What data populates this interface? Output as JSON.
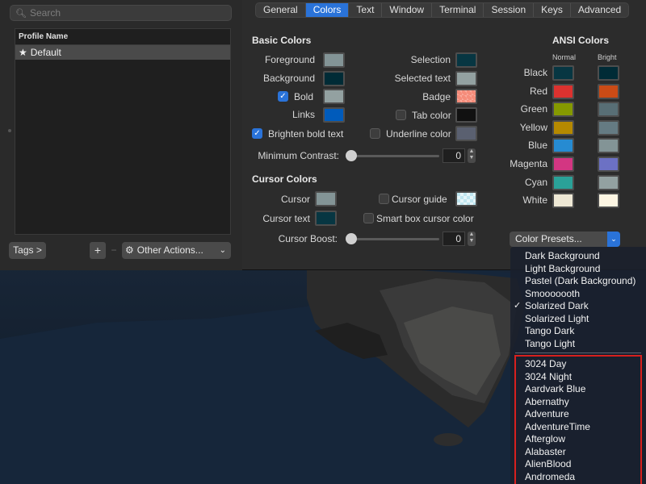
{
  "search": {
    "placeholder": "Search"
  },
  "profiles": {
    "header": "Profile Name",
    "items": [
      {
        "label": "Default",
        "is_default": true
      }
    ]
  },
  "bottom_bar": {
    "tags_label": "Tags >",
    "add_label": "+",
    "remove_label": "−",
    "other_actions_label": "Other Actions..."
  },
  "tabs": [
    {
      "label": "General",
      "active": false
    },
    {
      "label": "Colors",
      "active": true
    },
    {
      "label": "Text",
      "active": false
    },
    {
      "label": "Window",
      "active": false
    },
    {
      "label": "Terminal",
      "active": false
    },
    {
      "label": "Session",
      "active": false
    },
    {
      "label": "Keys",
      "active": false
    },
    {
      "label": "Advanced",
      "active": false
    }
  ],
  "basic_colors": {
    "title": "Basic Colors",
    "foreground": {
      "label": "Foreground",
      "color": "#839496"
    },
    "background": {
      "label": "Background",
      "color": "#002b36"
    },
    "bold": {
      "label": "Bold",
      "checked": true,
      "color": "#93a1a1"
    },
    "links": {
      "label": "Links",
      "color": "#005bbb"
    },
    "brighten_bold": {
      "label": "Brighten bold text",
      "checked": true
    },
    "selection": {
      "label": "Selection",
      "color": "#073642"
    },
    "selected_text": {
      "label": "Selected text",
      "color": "#93a1a1"
    },
    "badge": {
      "label": "Badge",
      "color": "#f58c7a"
    },
    "tab_color": {
      "label": "Tab color",
      "checked": false,
      "color": "#111111"
    },
    "underline_color": {
      "label": "Underline color",
      "checked": false,
      "color": "#5a6070"
    },
    "minimum_contrast": {
      "label": "Minimum Contrast:",
      "value": "0"
    }
  },
  "cursor_colors": {
    "title": "Cursor Colors",
    "cursor": {
      "label": "Cursor",
      "color": "#839496"
    },
    "cursor_text": {
      "label": "Cursor text",
      "color": "#073642"
    },
    "cursor_guide": {
      "label": "Cursor guide",
      "checked": false,
      "color": "#bfe6f0"
    },
    "smart_box": {
      "label": "Smart box cursor color",
      "checked": false
    },
    "cursor_boost": {
      "label": "Cursor Boost:",
      "value": "0"
    }
  },
  "ansi": {
    "title": "ANSI Colors",
    "normal_label": "Normal",
    "bright_label": "Bright",
    "rows": [
      {
        "name": "Black",
        "normal": "#073642",
        "bright": "#002b36"
      },
      {
        "name": "Red",
        "normal": "#dc322f",
        "bright": "#cb4b16"
      },
      {
        "name": "Green",
        "normal": "#859900",
        "bright": "#586e75"
      },
      {
        "name": "Yellow",
        "normal": "#b58900",
        "bright": "#657b83"
      },
      {
        "name": "Blue",
        "normal": "#268bd2",
        "bright": "#839496"
      },
      {
        "name": "Magenta",
        "normal": "#d33682",
        "bright": "#6c71c4"
      },
      {
        "name": "Cyan",
        "normal": "#2aa198",
        "bright": "#93a1a1"
      },
      {
        "name": "White",
        "normal": "#eee8d5",
        "bright": "#fdf6e3"
      }
    ]
  },
  "color_presets": {
    "button_label": "Color Presets...",
    "builtin": [
      {
        "label": "Dark Background",
        "checked": false
      },
      {
        "label": "Light Background",
        "checked": false
      },
      {
        "label": "Pastel (Dark Background)",
        "checked": false
      },
      {
        "label": "Smooooooth",
        "checked": false
      },
      {
        "label": "Solarized Dark",
        "checked": true
      },
      {
        "label": "Solarized Light",
        "checked": false
      },
      {
        "label": "Tango Dark",
        "checked": false
      },
      {
        "label": "Tango Light",
        "checked": false
      }
    ],
    "imported": [
      "3024 Day",
      "3024 Night",
      "Aardvark Blue",
      "Abernathy",
      "Adventure",
      "AdventureTime",
      "Afterglow",
      "Alabaster",
      "AlienBlood",
      "Andromeda"
    ]
  },
  "colors": {
    "accent": "#2a73d9",
    "highlight_box": "#d7201e"
  }
}
